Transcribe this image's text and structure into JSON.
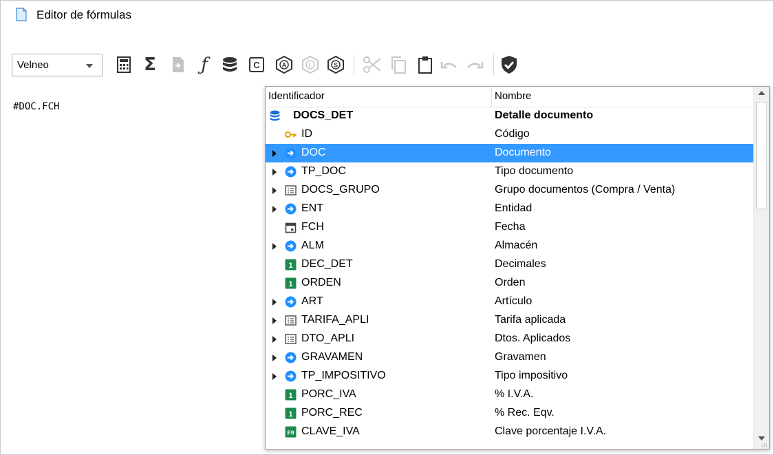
{
  "window": {
    "title": "Editor de fórmulas"
  },
  "toolbar": {
    "combo_value": "Velneo",
    "buttons": [
      {
        "icon": "calculator-icon",
        "enabled": true
      },
      {
        "icon": "sigma-icon",
        "enabled": true
      },
      {
        "icon": "document-arrow-icon",
        "enabled": false
      },
      {
        "icon": "function-icon",
        "enabled": true
      },
      {
        "icon": "database-icon",
        "enabled": true
      },
      {
        "icon": "constant-c-icon",
        "enabled": true
      },
      {
        "icon": "hexagon-a-icon",
        "enabled": true
      },
      {
        "icon": "hexagon-l-icon",
        "enabled": false
      },
      {
        "icon": "hexagon-s-icon",
        "enabled": true
      },
      {
        "icon": "cut-icon",
        "enabled": false
      },
      {
        "icon": "copy-icon",
        "enabled": false
      },
      {
        "icon": "paste-icon",
        "enabled": true
      },
      {
        "icon": "undo-icon",
        "enabled": false
      },
      {
        "icon": "redo-icon",
        "enabled": false
      },
      {
        "icon": "shield-check-icon",
        "enabled": true
      }
    ]
  },
  "editor": {
    "text": "#DOC.FCH"
  },
  "popup": {
    "columns": [
      "Identificador",
      "Nombre"
    ],
    "rows": [
      {
        "id": "DOCS_DET",
        "name": "Detalle documento",
        "icon": "database",
        "expand": false,
        "bold": true,
        "indent": 0
      },
      {
        "id": "ID",
        "name": "Código",
        "icon": "key",
        "expand": false,
        "indent": 1
      },
      {
        "id": "DOC",
        "name": "Documento",
        "icon": "link",
        "expand": true,
        "selected": true,
        "indent": 1
      },
      {
        "id": "TP_DOC",
        "name": "Tipo documento",
        "icon": "link",
        "expand": true,
        "indent": 1
      },
      {
        "id": "DOCS_GRUPO",
        "name": "Grupo documentos (Compra / Venta)",
        "icon": "list",
        "expand": true,
        "indent": 1
      },
      {
        "id": "ENT",
        "name": "Entidad",
        "icon": "link",
        "expand": true,
        "indent": 1
      },
      {
        "id": "FCH",
        "name": "Fecha",
        "icon": "calendar",
        "expand": false,
        "indent": 1
      },
      {
        "id": "ALM",
        "name": "Almacén",
        "icon": "link",
        "expand": true,
        "indent": 1
      },
      {
        "id": "DEC_DET",
        "name": "Decimales",
        "icon": "numeric",
        "expand": false,
        "indent": 1
      },
      {
        "id": "ORDEN",
        "name": "Orden",
        "icon": "numeric",
        "expand": false,
        "indent": 1
      },
      {
        "id": "ART",
        "name": "Artículo",
        "icon": "link",
        "expand": true,
        "indent": 1
      },
      {
        "id": "TARIFA_APLI",
        "name": "Tarifa aplicada",
        "icon": "list",
        "expand": true,
        "indent": 1
      },
      {
        "id": "DTO_APLI",
        "name": "Dtos. Aplicados",
        "icon": "list",
        "expand": true,
        "indent": 1
      },
      {
        "id": "GRAVAMEN",
        "name": "Gravamen",
        "icon": "link",
        "expand": true,
        "indent": 1
      },
      {
        "id": "TP_IMPOSITIVO",
        "name": "Tipo impositivo",
        "icon": "link",
        "expand": true,
        "indent": 1
      },
      {
        "id": "PORC_IVA",
        "name": "% I.V.A.",
        "icon": "numeric",
        "expand": false,
        "indent": 1
      },
      {
        "id": "PORC_REC",
        "name": "% Rec. Eqv.",
        "icon": "numeric",
        "expand": false,
        "indent": 1
      },
      {
        "id": "CLAVE_IVA",
        "name": "Clave porcentaje I.V.A.",
        "icon": "formula-f9",
        "expand": false,
        "indent": 1
      }
    ]
  },
  "colors": {
    "selection": "#3399ff",
    "link_icon": "#1e90ff",
    "numeric_icon": "#1b8a4c",
    "key_icon": "#e6a700",
    "database_icon": "#1e6fd9"
  }
}
